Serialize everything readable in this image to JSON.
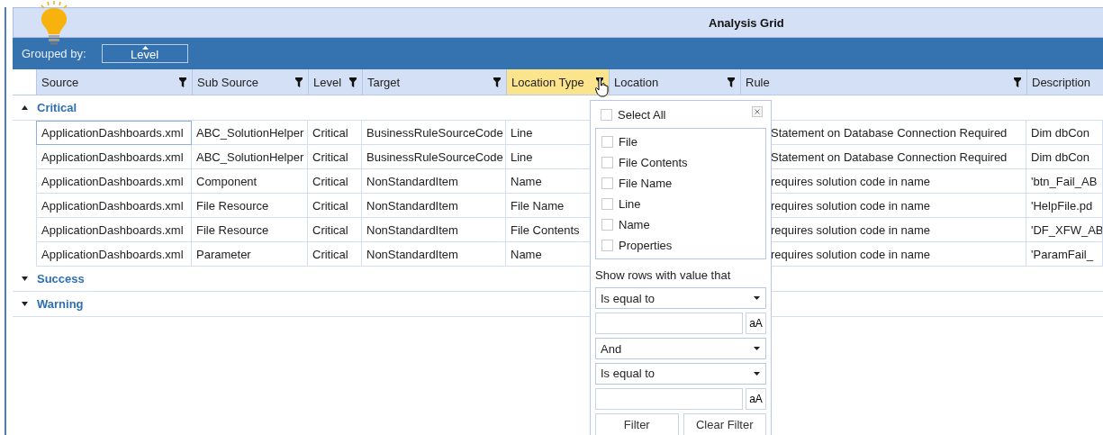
{
  "title": "Analysis Grid",
  "grouped_by": {
    "label": "Grouped by:",
    "chip": "Level"
  },
  "columns": [
    {
      "label": "Source",
      "filter": true,
      "selected": false
    },
    {
      "label": "Sub Source",
      "filter": true,
      "selected": false
    },
    {
      "label": "Level",
      "filter": true,
      "selected": false
    },
    {
      "label": "Target",
      "filter": true,
      "selected": false
    },
    {
      "label": "Location Type",
      "filter": true,
      "selected": true
    },
    {
      "label": "Location",
      "filter": true,
      "selected": false
    },
    {
      "label": "Rule",
      "filter": true,
      "selected": false
    },
    {
      "label": "Description",
      "filter": false,
      "selected": false
    }
  ],
  "groups": [
    {
      "name": "Critical",
      "expanded": true,
      "rows": [
        {
          "source": "ApplicationDashboards.xml",
          "sub_source": "ABC_SolutionHelper",
          "level": "Critical",
          "target": "BusinessRuleSourceCode",
          "location_type": "Line",
          "rule": "Statement on Database Connection Required",
          "description": "Dim dbCon"
        },
        {
          "source": "ApplicationDashboards.xml",
          "sub_source": "ABC_SolutionHelper",
          "level": "Critical",
          "target": "BusinessRuleSourceCode",
          "location_type": "Line",
          "rule": "Statement on Database Connection Required",
          "description": "Dim dbCon"
        },
        {
          "source": "ApplicationDashboards.xml",
          "sub_source": "Component",
          "level": "Critical",
          "target": "NonStandardItem",
          "location_type": "Name",
          "rule": "requires solution code in name",
          "description": "'btn_Fail_AB"
        },
        {
          "source": "ApplicationDashboards.xml",
          "sub_source": "File Resource",
          "level": "Critical",
          "target": "NonStandardItem",
          "location_type": "File Name",
          "rule": "requires solution code in name",
          "description": "'HelpFile.pd"
        },
        {
          "source": "ApplicationDashboards.xml",
          "sub_source": "File Resource",
          "level": "Critical",
          "target": "NonStandardItem",
          "location_type": "File Contents",
          "rule": "requires solution code in name",
          "description": "'DF_XFW_AB"
        },
        {
          "source": "ApplicationDashboards.xml",
          "sub_source": "Parameter",
          "level": "Critical",
          "target": "NonStandardItem",
          "location_type": "Name",
          "rule": "requires solution code in name",
          "description": "'ParamFail_"
        }
      ]
    },
    {
      "name": "Success",
      "expanded": false
    },
    {
      "name": "Warning",
      "expanded": false
    }
  ],
  "filter_popup": {
    "select_all": {
      "label": "Select All",
      "checked": false
    },
    "options": [
      {
        "label": "File",
        "checked": false
      },
      {
        "label": "File Contents",
        "checked": false
      },
      {
        "label": "File Name",
        "checked": false
      },
      {
        "label": "Line",
        "checked": false
      },
      {
        "label": "Name",
        "checked": false
      },
      {
        "label": "Properties",
        "checked": false
      }
    ],
    "condition_label": "Show rows with value that",
    "operator_1": "Is equal to",
    "case_button_1": "aA",
    "logic": "And",
    "operator_2": "Is equal to",
    "case_button_2": "aA",
    "buttons": [
      "Filter",
      "Clear Filter"
    ]
  }
}
